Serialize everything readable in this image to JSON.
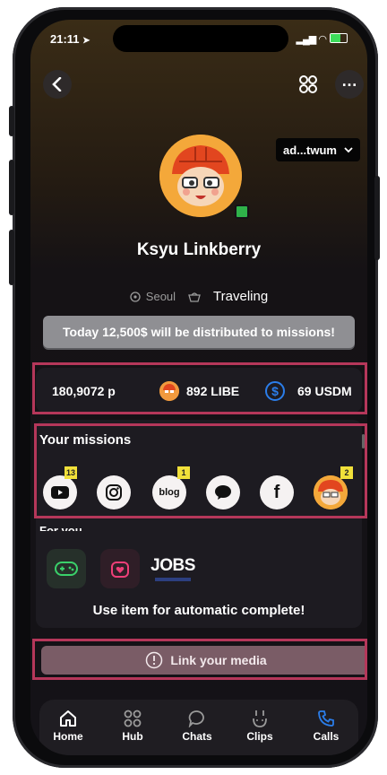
{
  "status_bar": {
    "time": "21:11",
    "signal": "📶",
    "battery": "▮"
  },
  "header": {
    "account_label": "ad...twum"
  },
  "profile": {
    "name": "Ksyu Linkberry",
    "location": "Seoul",
    "activity": "Traveling"
  },
  "banner": {
    "text": "Today 12,500$ will be distributed to missions!"
  },
  "balances": {
    "points": "180,9072 p",
    "libe": "892 LIBE",
    "usdm": "69 USDM"
  },
  "missions": {
    "title": "Your missions",
    "items": [
      {
        "name": "youtube",
        "badge": "13"
      },
      {
        "name": "instagram",
        "badge": ""
      },
      {
        "name": "blog",
        "label": "blog",
        "badge": "1"
      },
      {
        "name": "messenger",
        "badge": ""
      },
      {
        "name": "facebook",
        "label": "f",
        "badge": ""
      },
      {
        "name": "avatar",
        "badge": "2"
      }
    ]
  },
  "for_you": {
    "title": "For you",
    "jobs_label": "JOBS",
    "use_item_text": "Use item for automatic complete!"
  },
  "link_media": {
    "label": "Link your media"
  },
  "tabs": [
    {
      "label": "Home",
      "icon": "home-icon"
    },
    {
      "label": "Hub",
      "icon": "grid-icon"
    },
    {
      "label": "Chats",
      "icon": "chat-icon"
    },
    {
      "label": "Clips",
      "icon": "clips-icon"
    },
    {
      "label": "Calls",
      "icon": "phone-icon"
    }
  ],
  "colors": {
    "highlight_border": "#b5375a",
    "badge": "#f1e03a",
    "banner": "#8f8f93",
    "link_button": "#7a5c66",
    "usdm": "#2b7de9"
  }
}
